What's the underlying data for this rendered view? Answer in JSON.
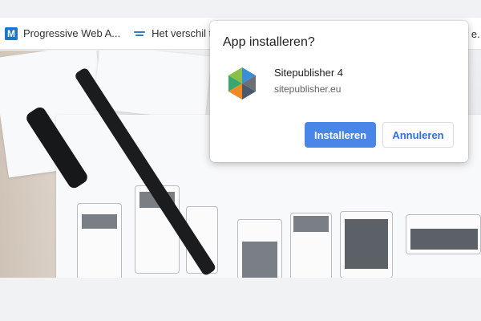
{
  "bookmarks": [
    {
      "label": "Progressive Web A...",
      "icon": "m-letter-icon"
    },
    {
      "label": "Het verschil tus",
      "icon": "site-logo-icon"
    }
  ],
  "bookmark_overflow": {
    "label": "r e..."
  },
  "dialog": {
    "title": "App installeren?",
    "app_name": "Sitepublisher 4",
    "app_host": "sitepublisher.eu",
    "install_label": "Installeren",
    "cancel_label": "Annuleren",
    "accent_color": "#4a85e8"
  }
}
